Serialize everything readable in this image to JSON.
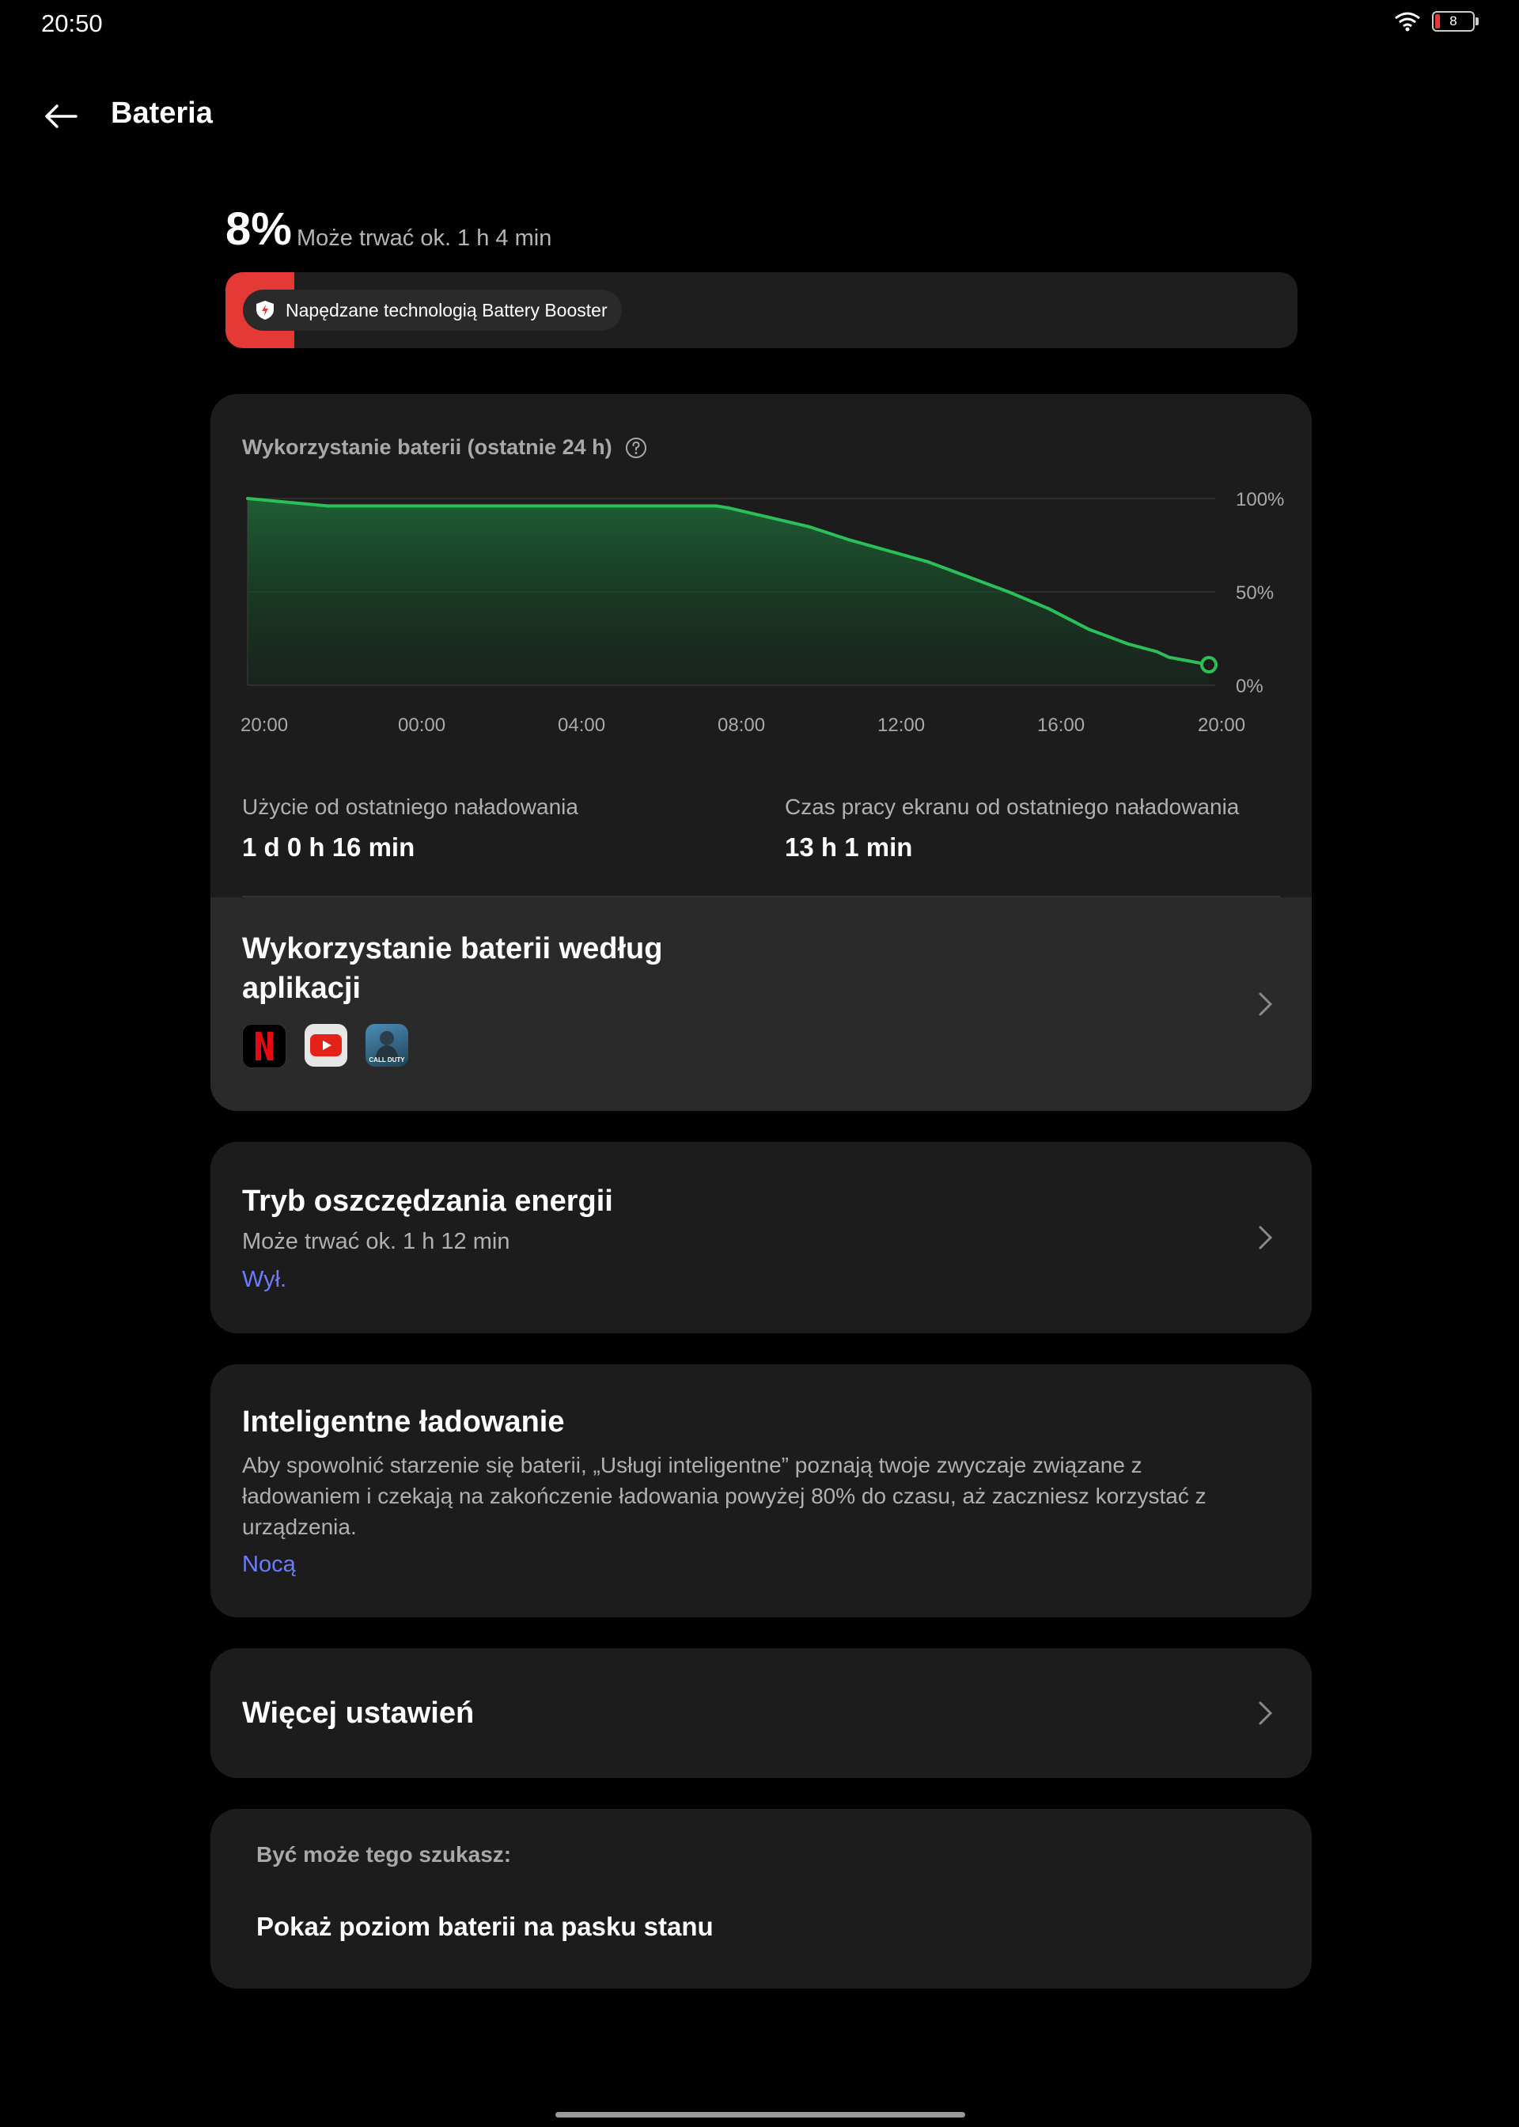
{
  "status": {
    "time": "20:50",
    "battery_text": "8"
  },
  "header": {
    "title": "Bateria"
  },
  "summary": {
    "percent": "8%",
    "estimate": "Może trwać ok. 1 h 4 min",
    "level_fraction": 0.08,
    "booster": "Napędzane technologią Battery Booster"
  },
  "usage_card": {
    "title": "Wykorzystanie baterii (ostatnie 24 h)",
    "since_charge_label": "Użycie od ostatniego naładowania",
    "since_charge_value": "1 d 0 h 16 min",
    "screen_label": "Czas pracy ekranu od ostatniego naładowania",
    "screen_value": "13 h 1 min"
  },
  "chart_data": {
    "type": "area",
    "title": "Wykorzystanie baterii (ostatnie 24 h)",
    "x_labels": [
      "20:00",
      "00:00",
      "04:00",
      "08:00",
      "12:00",
      "16:00",
      "20:00"
    ],
    "y_ticks": [
      "100%",
      "50%",
      "0%"
    ],
    "ylim": [
      0,
      100
    ],
    "x": [
      0,
      1,
      2,
      4,
      8,
      11.7,
      12,
      13,
      14,
      15,
      16,
      17,
      18,
      19,
      20,
      21,
      22,
      22.7,
      23,
      24
    ],
    "values": [
      100,
      98,
      96,
      96,
      96,
      96,
      95,
      90,
      85,
      78,
      72,
      66,
      58,
      50,
      41,
      30,
      22,
      18,
      15,
      11
    ],
    "color": "#2bbf5a",
    "grid": true
  },
  "apps_section": {
    "title_line1": "Wykorzystanie baterii według",
    "title_line2": "aplikacji",
    "icons": [
      "netflix-icon",
      "youtube-icon",
      "call-of-duty-icon"
    ],
    "cod_text": "CALL DUTY"
  },
  "power_saving": {
    "title": "Tryb oszczędzania energii",
    "estimate": "Może trwać ok. 1 h 12 min",
    "state": "Wył."
  },
  "smart_charging": {
    "title": "Inteligentne ładowanie",
    "desc1": "Aby spowolnić starzenie się baterii, „Usługi inteligentne” poznają twoje zwyczaje związane z",
    "desc2": "ładowaniem i czekają na zakończenie ładowania powyżej 80% do czasu, aż zaczniesz korzystać z",
    "desc3": "urządzenia.",
    "mode": "Nocą"
  },
  "more_settings": {
    "title": "Więcej ustawień"
  },
  "suggestions": {
    "heading": "Być może tego szukasz:",
    "item": "Pokaż poziom baterii na pasku stanu"
  }
}
